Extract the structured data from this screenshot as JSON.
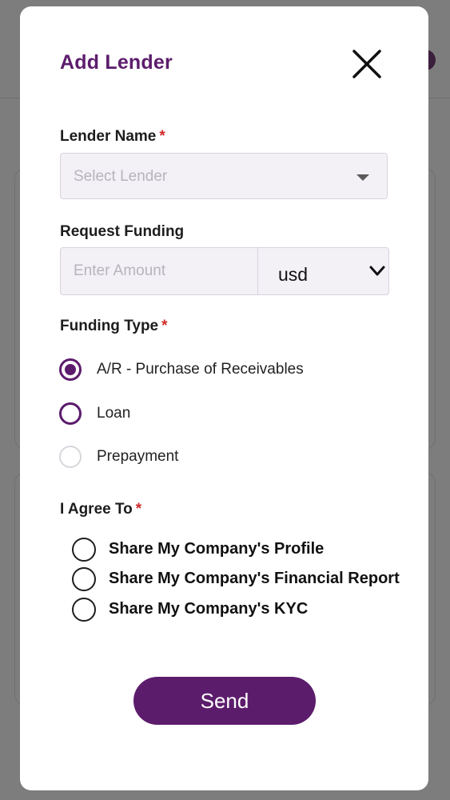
{
  "modal": {
    "title": "Add Lender",
    "close_icon": "close-icon"
  },
  "lender_name": {
    "label": "Lender Name",
    "required_mark": "*",
    "placeholder": "Select Lender",
    "caret_icon": "caret-down-icon"
  },
  "request_funding": {
    "label": "Request Funding",
    "placeholder": "Enter Amount",
    "currency_value": "usd",
    "currency_icon": "chevron-down-icon"
  },
  "funding_type": {
    "label": "Funding Type",
    "required_mark": "*",
    "options": [
      {
        "label": "A/R - Purchase of Receivables",
        "selected": true
      },
      {
        "label": "Loan",
        "selected": false
      },
      {
        "label": "Prepayment",
        "selected": false
      }
    ]
  },
  "agree": {
    "label": "I Agree To",
    "required_mark": "*",
    "options": [
      {
        "label": "Share My Company's Profile"
      },
      {
        "label": "Share My Company's Financial Report"
      },
      {
        "label": "Share My Company's KYC"
      }
    ]
  },
  "actions": {
    "send_label": "Send"
  },
  "colors": {
    "brand": "#5c1c6c",
    "required": "#d12a2a",
    "field_bg": "#f3f0f6",
    "overlay": "#7d7d7d"
  }
}
